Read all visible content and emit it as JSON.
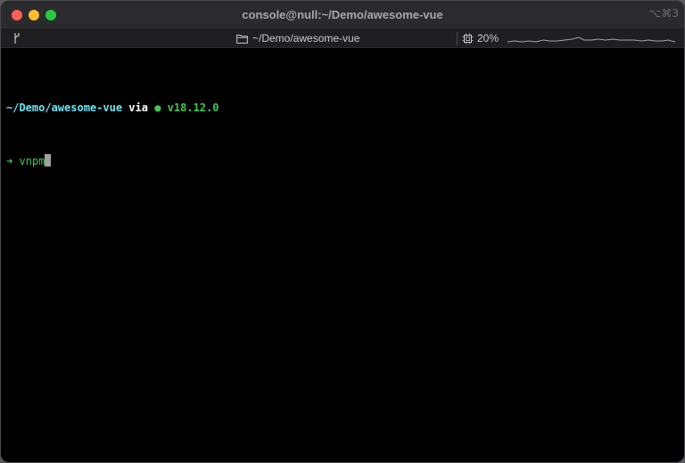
{
  "window": {
    "title": "console@null:~/Demo/awesome-vue",
    "shortcut": "⌥⌘3"
  },
  "statusbar": {
    "branch_icon": "git-branch-icon",
    "folder_icon": "folder-icon",
    "folder_path": "~/Demo/awesome-vue",
    "cpu_icon": "cpu-chip-icon",
    "cpu_percent": "20%"
  },
  "terminal": {
    "prompt_path": "~/Demo/awesome-vue",
    "prompt_via": "via",
    "node_dot": "●",
    "node_version": "v18.12.0",
    "arrow": "➜",
    "command": "vnpm"
  },
  "colors": {
    "terminal_bg": "#000000",
    "path": "#6fe3f5",
    "green": "#3fca56",
    "titlebar": "#2b2b2e"
  }
}
